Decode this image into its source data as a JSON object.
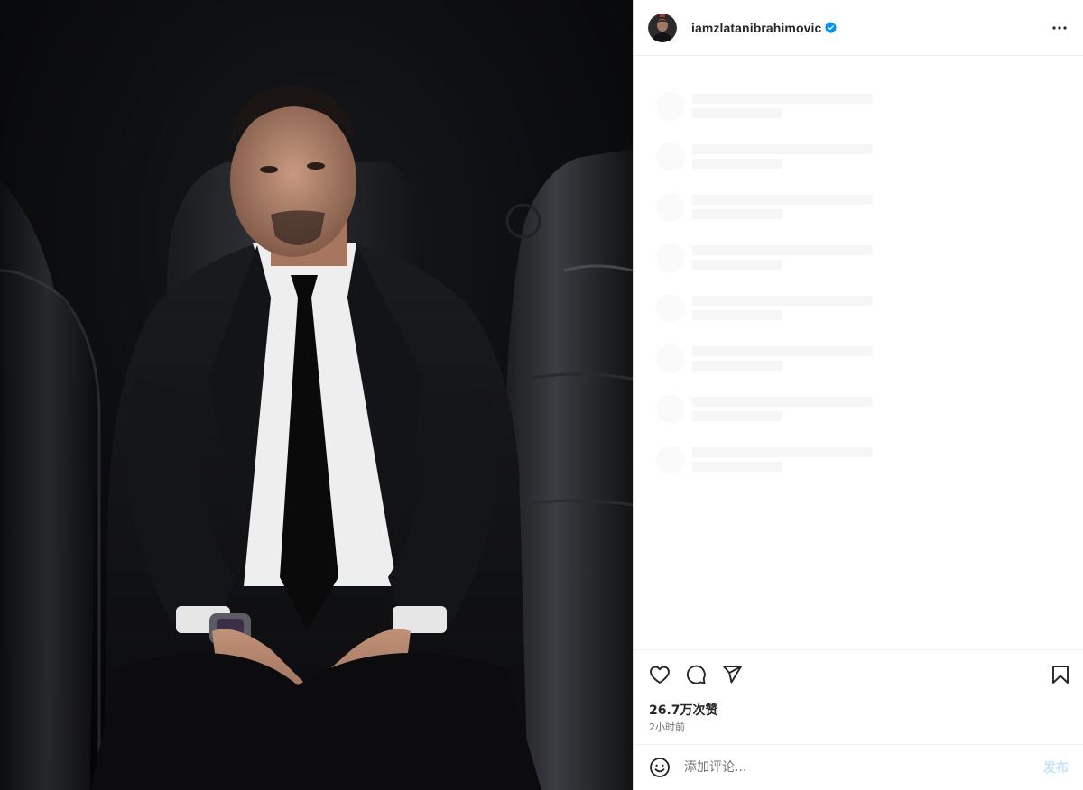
{
  "post": {
    "media": {
      "description_icon": "photo-person-on-bench"
    },
    "header": {
      "username": "iamzlatanibrahimovic",
      "verified": true,
      "more_icon": "more-horizontal-icon"
    },
    "comments_loading_rows": 8,
    "actions": {
      "like_icon": "heart-icon",
      "comment_icon": "comment-icon",
      "share_icon": "send-icon",
      "save_icon": "bookmark-icon"
    },
    "likes_text": "26.7万次赞",
    "time_text": "2小时前",
    "comment_box": {
      "emoji_icon": "emoji-icon",
      "placeholder": "添加评论...",
      "post_label": "发布"
    }
  },
  "colors": {
    "verified_blue": "#0095f6",
    "post_button_disabled": "#c5e1fc",
    "skeleton": "#f6f6f6",
    "divider": "#efefef"
  }
}
